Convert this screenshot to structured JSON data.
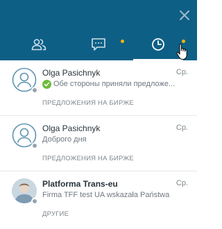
{
  "header": {
    "tabs": [
      {
        "name": "contacts",
        "icon": "users-icon",
        "active": false
      },
      {
        "name": "messages",
        "icon": "chat-icon",
        "active": false,
        "notification": true
      },
      {
        "name": "history",
        "icon": "clock-icon",
        "active": true,
        "notification": true
      }
    ]
  },
  "colors": {
    "header": "#0e5f86",
    "notification_dot": "#f3b800",
    "status_offline": "#9aa3ab",
    "check": "#6dbb3a"
  },
  "conversations": [
    {
      "name": "Olga Pasichnyk",
      "date": "Ср.",
      "preview": "Обе стороны приняли предложе...",
      "category": "ПРЕДЛОЖЕНИЯ НА БИРЖЕ",
      "avatar": "default-avatar-icon",
      "status": "offline"
    },
    {
      "name": "Olga Pasichnyk",
      "date": "Ср.",
      "preview": "Доброго дня",
      "category": "ПРЕДЛОЖЕНИЯ НА БИРЖЕ",
      "avatar": "default-avatar-icon",
      "status": "offline"
    },
    {
      "name": "Platforma Trans-eu",
      "date": "Ср.",
      "preview": "Firma TFF test UA wskazała Państwa",
      "category": "ДРУГИЕ",
      "avatar": "photo",
      "status": "offline"
    }
  ]
}
